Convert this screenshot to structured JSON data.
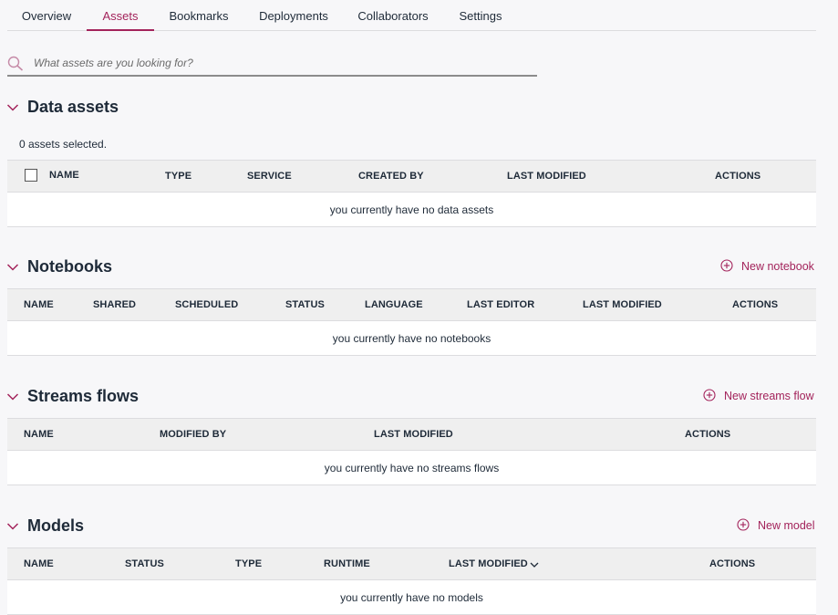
{
  "tabs": [
    {
      "label": "Overview",
      "active": false
    },
    {
      "label": "Assets",
      "active": true
    },
    {
      "label": "Bookmarks",
      "active": false
    },
    {
      "label": "Deployments",
      "active": false
    },
    {
      "label": "Collaborators",
      "active": false
    },
    {
      "label": "Settings",
      "active": false
    }
  ],
  "search": {
    "placeholder": "What assets are you looking for?",
    "value": ""
  },
  "colors": {
    "accent": "#a3235b",
    "text": "#1e2a38",
    "header_bg": "#efefef",
    "page_bg": "#f7f7f9"
  },
  "data_assets": {
    "title": "Data assets",
    "selected_text": "0 assets selected.",
    "columns": [
      "NAME",
      "TYPE",
      "SERVICE",
      "CREATED BY",
      "LAST MODIFIED",
      "ACTIONS"
    ],
    "empty_text": "you currently have no data assets"
  },
  "notebooks": {
    "title": "Notebooks",
    "new_label": "New notebook",
    "columns": [
      "NAME",
      "SHARED",
      "SCHEDULED",
      "STATUS",
      "LANGUAGE",
      "LAST EDITOR",
      "LAST MODIFIED",
      "ACTIONS"
    ],
    "empty_text": "you currently have no notebooks"
  },
  "streams_flows": {
    "title": "Streams flows",
    "new_label": "New streams flow",
    "columns": [
      "NAME",
      "MODIFIED BY",
      "LAST MODIFIED",
      "ACTIONS"
    ],
    "empty_text": "you currently have no streams flows"
  },
  "models": {
    "title": "Models",
    "new_label": "New model",
    "columns": [
      "NAME",
      "STATUS",
      "TYPE",
      "RUNTIME",
      "LAST MODIFIED",
      "ACTIONS"
    ],
    "empty_text": "you currently have no models"
  },
  "icons": {
    "search": "search-icon",
    "collapse": "chevron-down-icon",
    "add": "plus-circle-icon",
    "sort": "chevron-down-icon"
  }
}
